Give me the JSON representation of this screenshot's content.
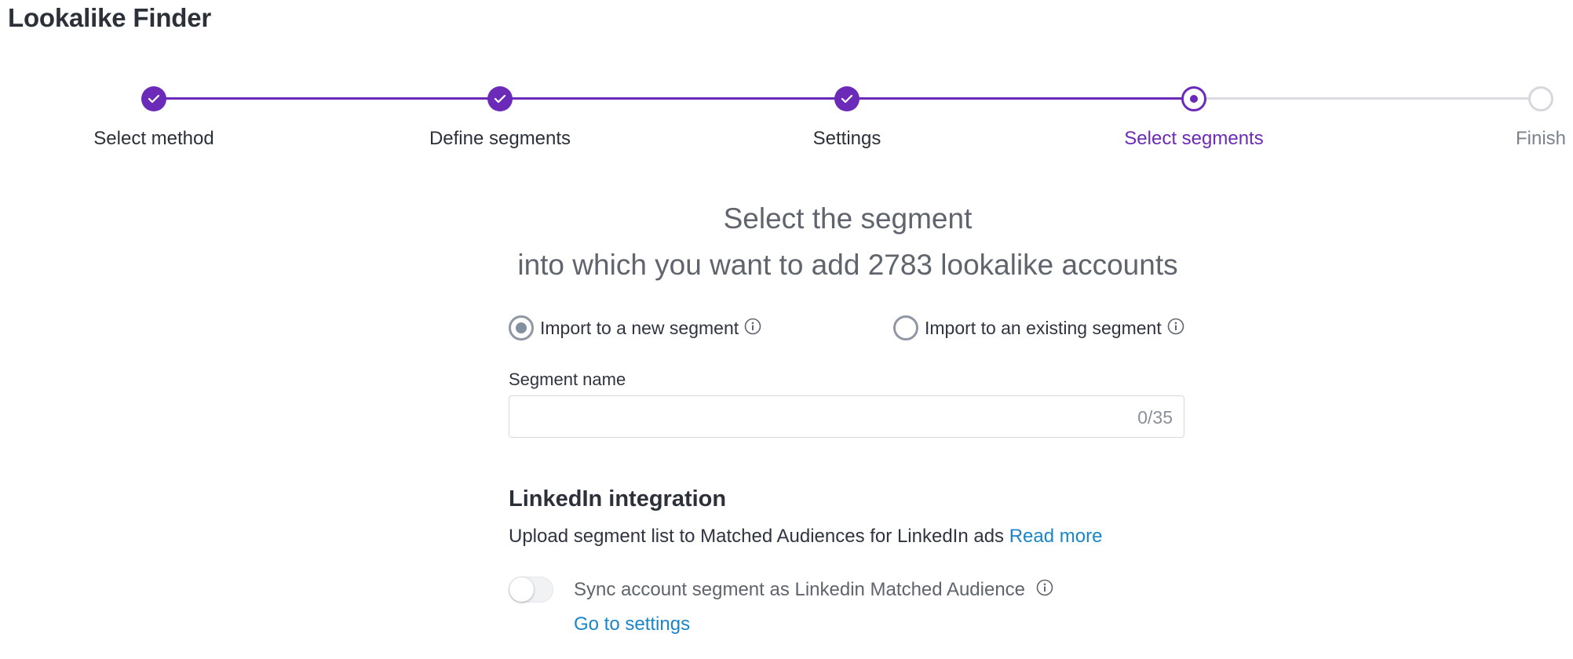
{
  "app": {
    "title": "Lookalike Finder"
  },
  "stepper": {
    "steps": [
      {
        "label": "Select method",
        "state": "done"
      },
      {
        "label": "Define segments",
        "state": "done"
      },
      {
        "label": "Settings",
        "state": "done"
      },
      {
        "label": "Select segments",
        "state": "current"
      },
      {
        "label": "Finish",
        "state": "todo"
      }
    ],
    "accent_color": "#6b2bb8"
  },
  "main": {
    "heading_line1": "Select the segment",
    "heading_line2": "into which you want to add 2783 lookalike accounts",
    "import_options": [
      {
        "label": "Import to a new segment",
        "selected": true,
        "icon": "info-icon"
      },
      {
        "label": "Import to an existing segment",
        "selected": false,
        "icon": "info-icon"
      }
    ],
    "segment_name": {
      "label": "Segment name",
      "value": "",
      "counter": "0/35"
    }
  },
  "linkedin": {
    "title": "LinkedIn integration",
    "description": "Upload segment list to Matched Audiences for LinkedIn ads",
    "read_more": "Read more",
    "sync_label": "Sync account segment as Linkedin Matched Audience",
    "sync_enabled": false,
    "settings_link": "Go to settings",
    "link_color": "#1a85c8"
  }
}
